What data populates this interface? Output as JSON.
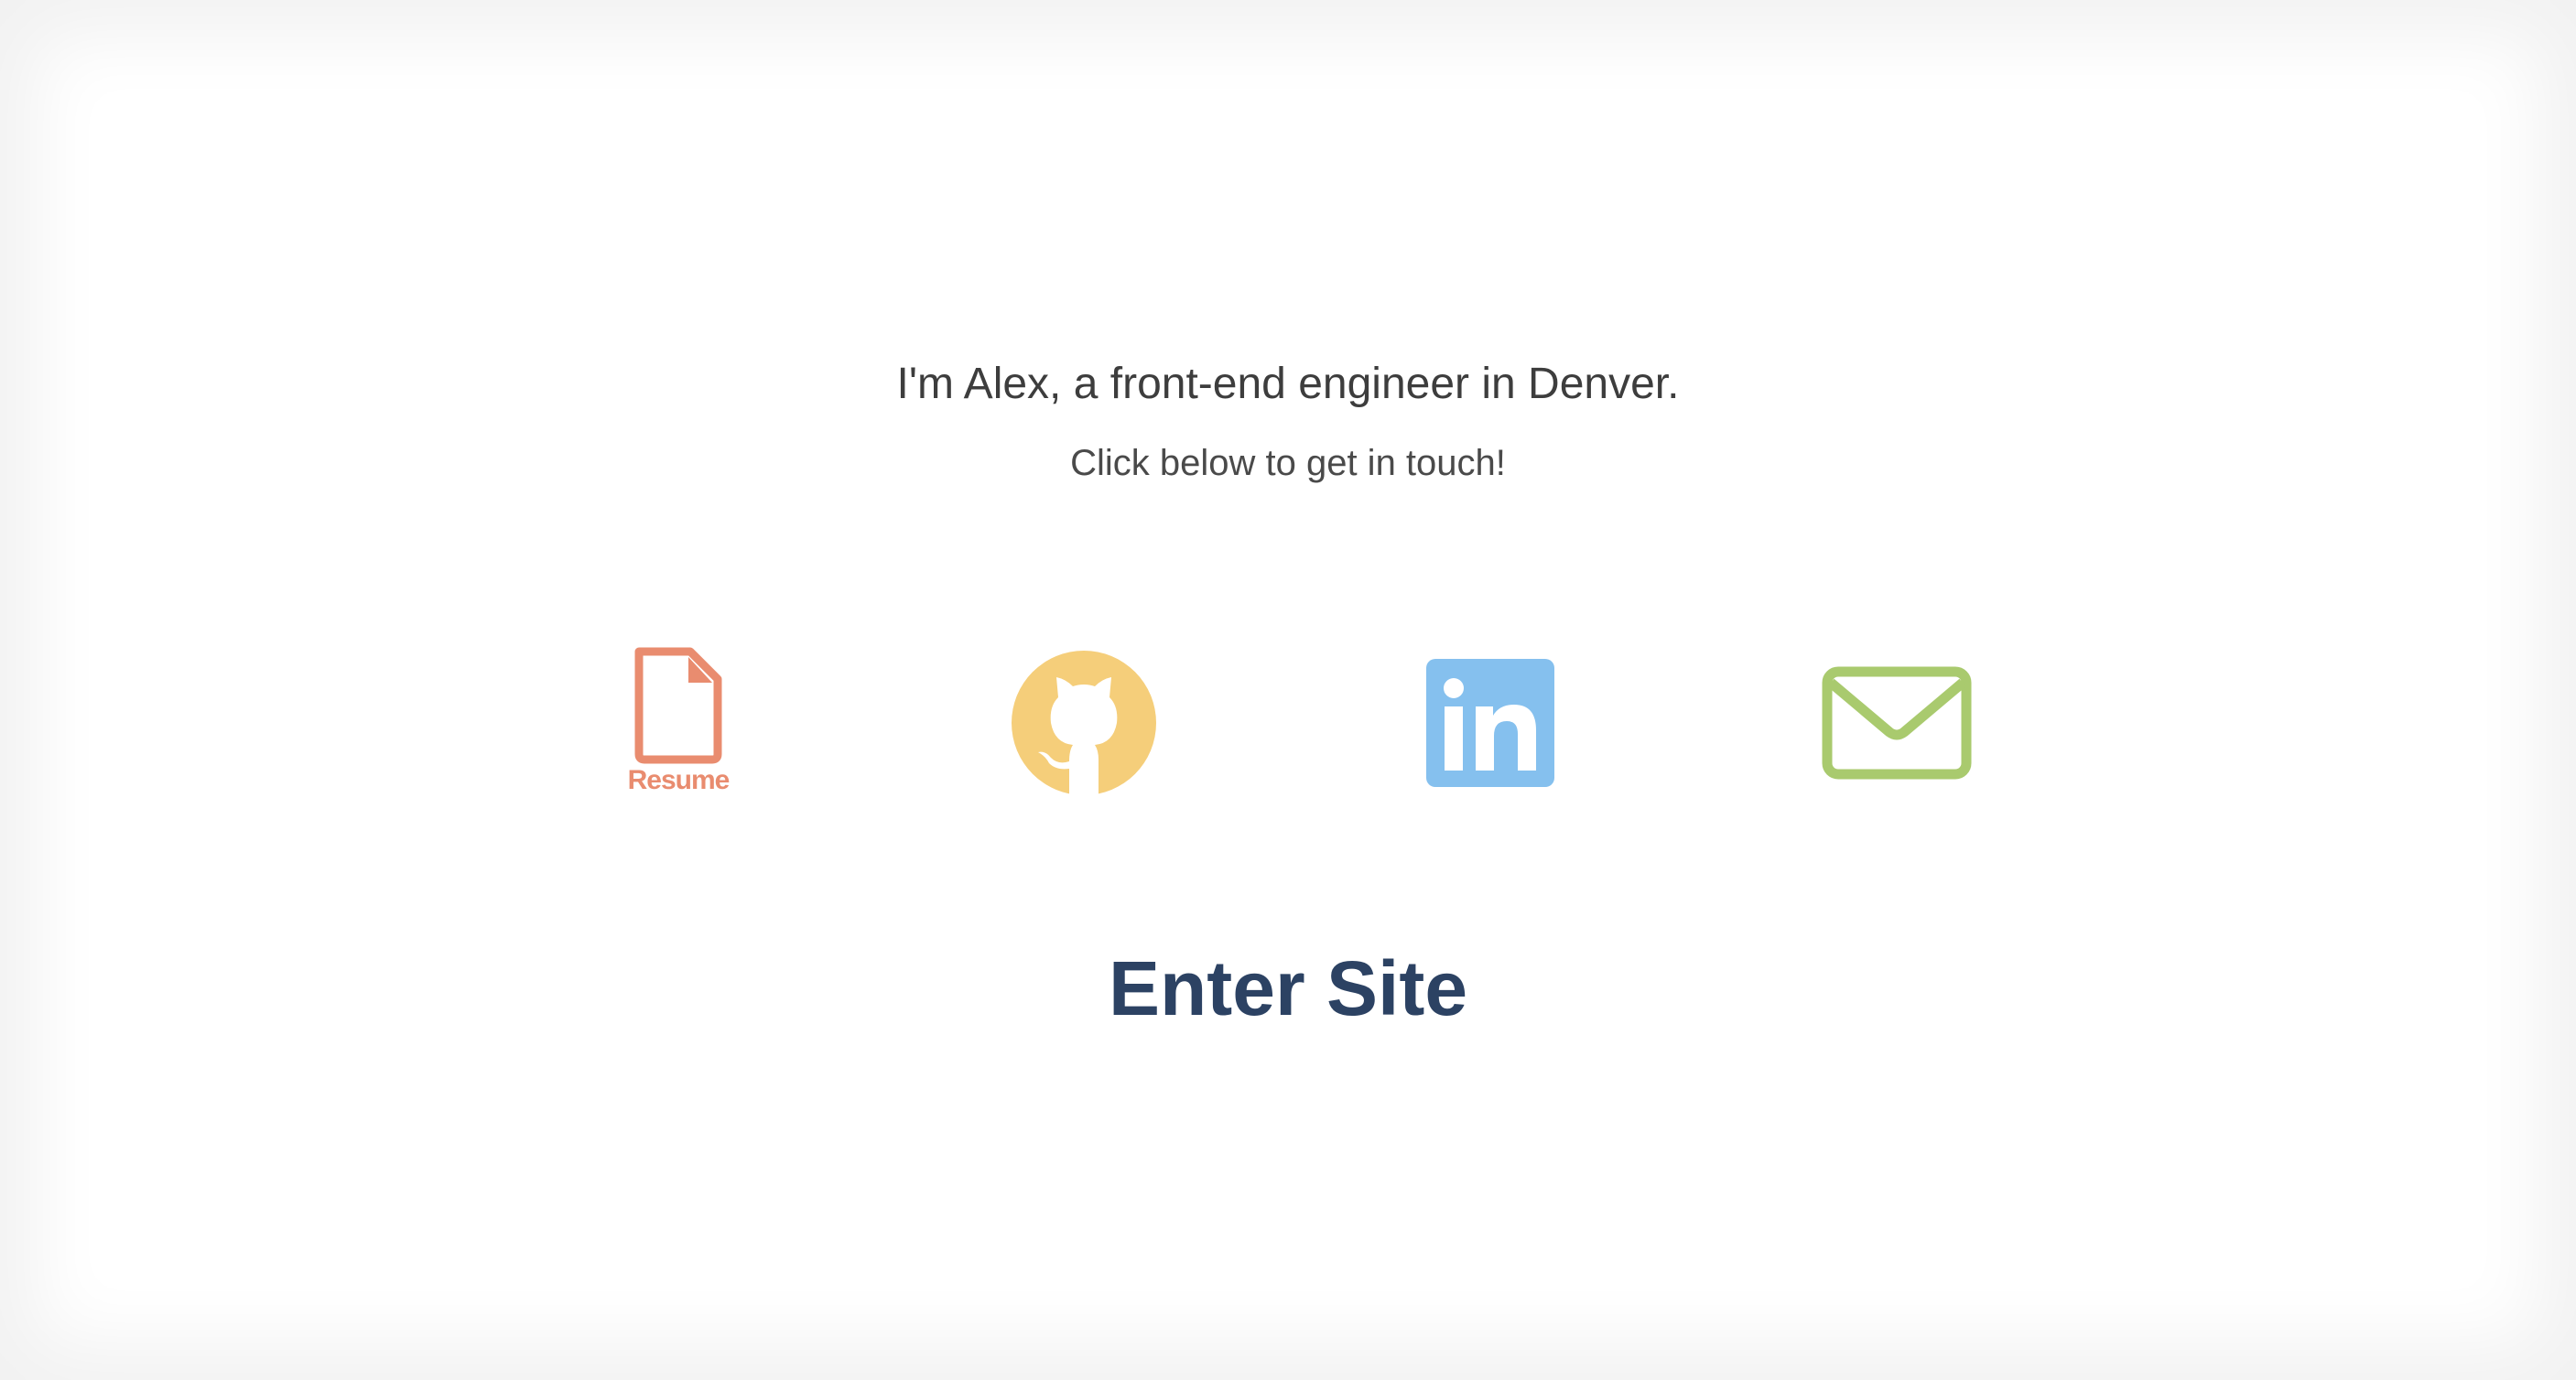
{
  "intro": {
    "headline": "I'm Alex, a front-end engineer in Denver.",
    "subline": "Click below to get in touch!"
  },
  "links": {
    "resume": {
      "label": "Resume",
      "icon": "document-icon",
      "color": "#e98c6f"
    },
    "github": {
      "icon": "github-octocat-icon",
      "color": "#f5ce7a"
    },
    "linkedin": {
      "icon": "linkedin-icon",
      "color": "#85c0ee"
    },
    "email": {
      "icon": "envelope-icon",
      "color": "#a9ca6e"
    }
  },
  "cta": {
    "label": "Enter Site",
    "color": "#2c4263"
  }
}
